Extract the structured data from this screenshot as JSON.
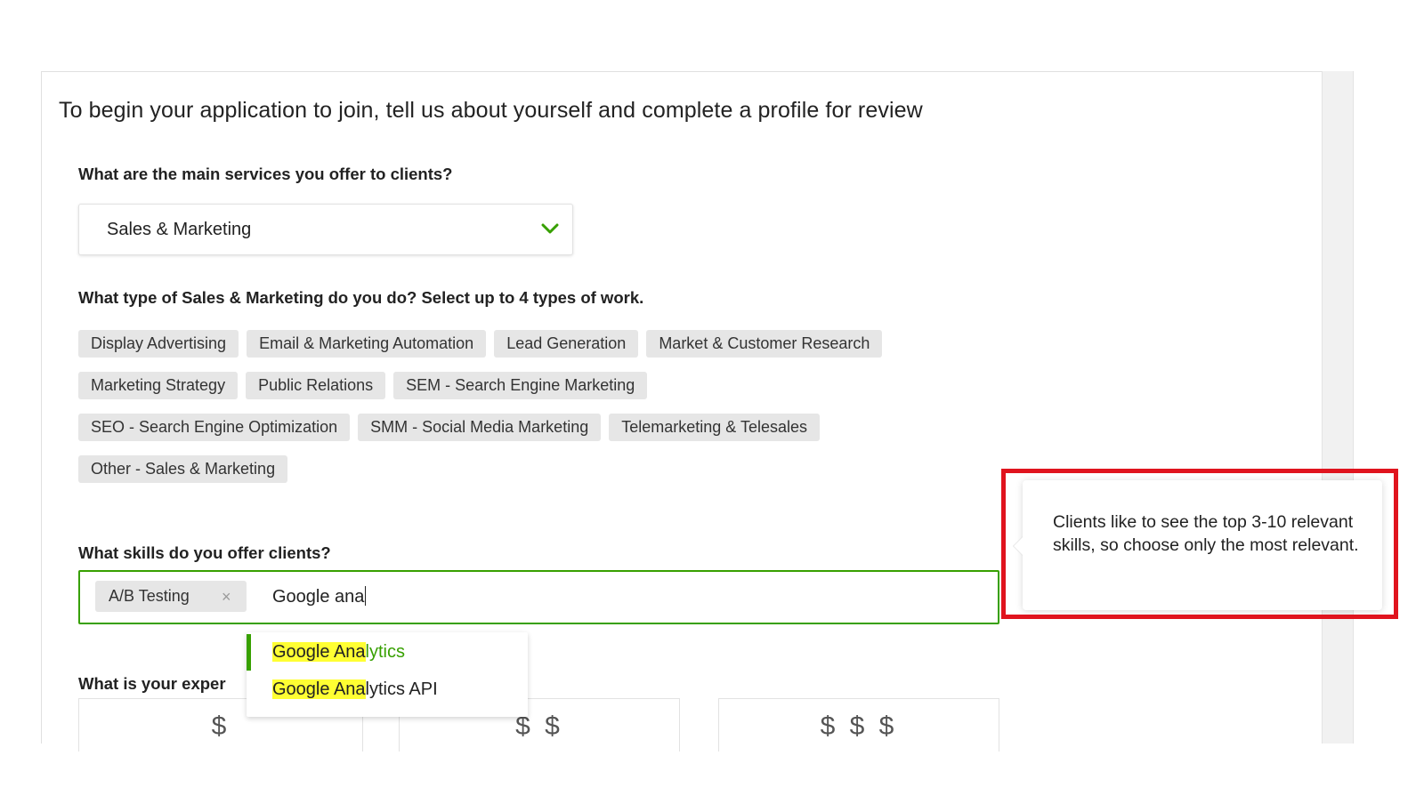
{
  "page": {
    "title": "To begin your application to join, tell us about yourself and complete a profile for review"
  },
  "services": {
    "question": "What are the main services you offer to clients?",
    "selected": "Sales & Marketing"
  },
  "work_types": {
    "question": "What type of Sales & Marketing do you do? Select up to 4 types of work.",
    "rows": [
      [
        "Display Advertising",
        "Email & Marketing Automation",
        "Lead Generation",
        "Market & Customer Research"
      ],
      [
        "Marketing Strategy",
        "Public Relations",
        "SEM - Search Engine Marketing"
      ],
      [
        "SEO - Search Engine Optimization",
        "SMM - Social Media Marketing",
        "Telemarketing & Telesales"
      ],
      [
        "Other - Sales & Marketing"
      ]
    ]
  },
  "skills": {
    "question": "What skills do you offer clients?",
    "selected_token": "A/B Testing",
    "remove_glyph": "×",
    "typed_text": "Google ana",
    "suggestions": [
      {
        "match": "Google Ana",
        "rest": "lytics"
      },
      {
        "match": "Google Ana",
        "rest": "lytics API"
      }
    ]
  },
  "experience": {
    "question_visible": "What is your exper",
    "levels": [
      "$",
      "$ $",
      "$ $ $"
    ]
  },
  "tooltip": {
    "text": "Clients like to see the top 3-10 relevant skills, so choose only the most relevant."
  },
  "colors": {
    "accent_green": "#37a000",
    "highlight_yellow": "#ffff33",
    "annotation_red": "#e0141e",
    "chip_bg": "#e6e6e6"
  }
}
